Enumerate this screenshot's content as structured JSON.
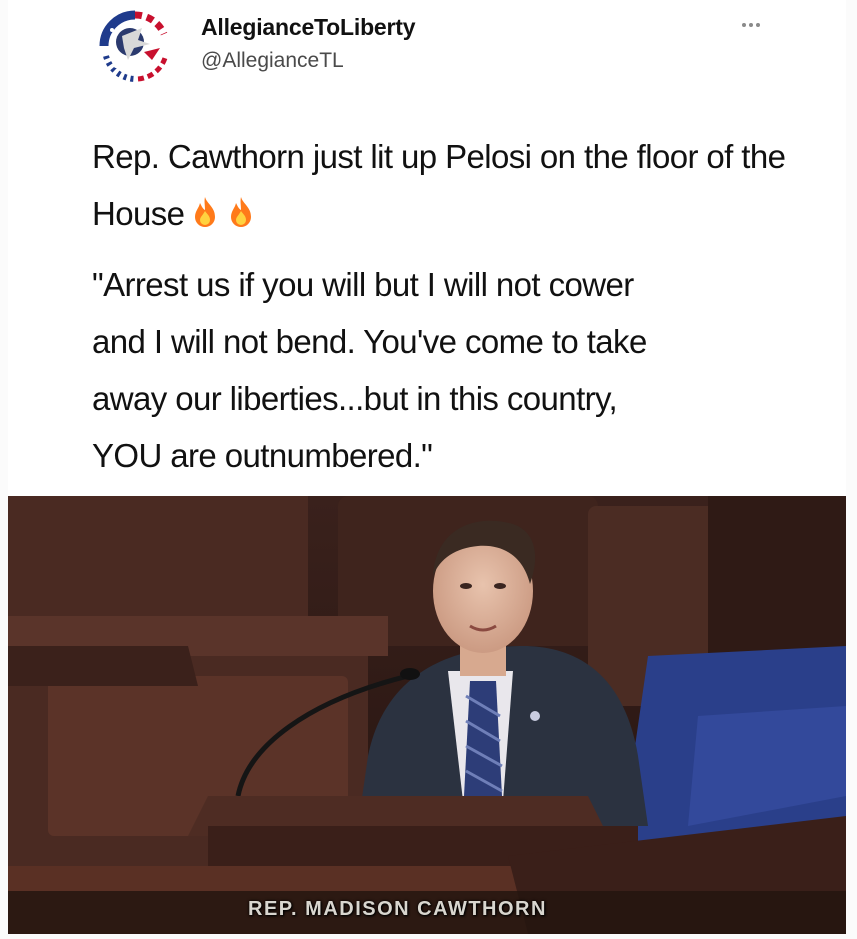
{
  "tweet": {
    "display_name": "AllegianceToLiberty",
    "handle": "@AllegianceTL",
    "more_icon": "ellipsis-icon",
    "paragraph_1": "Rep. Cawthorn just lit up Pelosi on the floor of the House",
    "paragraph_1_emoji": [
      "fire-icon",
      "fire-icon"
    ],
    "quote_lines": [
      "\"Arrest us if you will but I will not cower",
      "and I will not bend. You've come to take",
      "away our liberties...but in this country,",
      "YOU are outnumbered.\""
    ]
  },
  "media": {
    "lower_third_caption": "REP. MADISON CAWTHORN"
  },
  "colors": {
    "background": "#ffffff",
    "text": "#111111",
    "handle": "#4a4a4a",
    "chamber_wood": "#4a2a22",
    "suit": "#2b3240",
    "tie": "#2d3d78",
    "carpet": "#2a3f8a",
    "fire": "#ff7a1a"
  }
}
